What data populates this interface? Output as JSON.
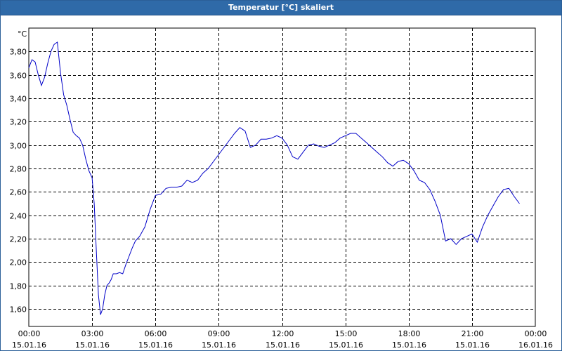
{
  "window": {
    "title": "Temperatur [°C] skaliert"
  },
  "chart_data": {
    "type": "line",
    "title": "Temperatur [°C] skaliert",
    "ylabel": "°C",
    "xlabel": "",
    "grid": true,
    "line_color": "#0000c8",
    "ylim": [
      1.45,
      4.0
    ],
    "y_ticks": [
      "1,60",
      "1,80",
      "2,00",
      "2,20",
      "2,40",
      "2,60",
      "2,80",
      "3,00",
      "3,20",
      "3,40",
      "3,60",
      "3,80"
    ],
    "x_ticks": [
      {
        "time": "00:00",
        "date": "15.01.16"
      },
      {
        "time": "03:00",
        "date": "15.01.16"
      },
      {
        "time": "06:00",
        "date": "15.01.16"
      },
      {
        "time": "09:00",
        "date": "15.01.16"
      },
      {
        "time": "12:00",
        "date": "15.01.16"
      },
      {
        "time": "15:00",
        "date": "15.01.16"
      },
      {
        "time": "18:00",
        "date": "15.01.16"
      },
      {
        "time": "21:00",
        "date": "15.01.16"
      },
      {
        "time": "00:00",
        "date": "16.01.16"
      }
    ],
    "x_range_hours": [
      0,
      24
    ],
    "series": [
      {
        "name": "",
        "x_hours": [
          0.0,
          0.15,
          0.3,
          0.45,
          0.6,
          0.75,
          0.9,
          1.05,
          1.2,
          1.35,
          1.5,
          1.65,
          1.8,
          1.95,
          2.1,
          2.25,
          2.4,
          2.55,
          2.7,
          2.85,
          3.0,
          3.1,
          3.2,
          3.3,
          3.4,
          3.5,
          3.6,
          3.7,
          3.8,
          3.9,
          4.0,
          4.15,
          4.3,
          4.45,
          4.6,
          4.75,
          4.9,
          5.05,
          5.25,
          5.5,
          5.75,
          6.0,
          6.25,
          6.5,
          6.75,
          7.0,
          7.25,
          7.5,
          7.75,
          8.0,
          8.25,
          8.5,
          8.75,
          9.0,
          9.25,
          9.5,
          9.75,
          10.0,
          10.25,
          10.5,
          10.75,
          11.0,
          11.25,
          11.5,
          11.75,
          12.0,
          12.25,
          12.5,
          12.75,
          13.0,
          13.25,
          13.5,
          13.75,
          14.0,
          14.25,
          14.5,
          14.75,
          15.0,
          15.25,
          15.5,
          15.75,
          16.0,
          16.25,
          16.5,
          16.75,
          17.0,
          17.25,
          17.5,
          17.75,
          18.0,
          18.25,
          18.5,
          18.75,
          19.0,
          19.25,
          19.5,
          19.75,
          20.0,
          20.25,
          20.5,
          20.75,
          21.0,
          21.25,
          21.5,
          21.75,
          22.0,
          22.25,
          22.5,
          22.75,
          23.0,
          23.25,
          23.5,
          23.75,
          24.0
        ],
        "y": [
          3.66,
          3.73,
          3.71,
          3.6,
          3.51,
          3.58,
          3.7,
          3.8,
          3.86,
          3.88,
          3.62,
          3.43,
          3.34,
          3.22,
          3.11,
          3.08,
          3.06,
          3.0,
          2.88,
          2.78,
          2.72,
          2.5,
          2.1,
          1.72,
          1.55,
          1.6,
          1.72,
          1.8,
          1.82,
          1.85,
          1.9,
          1.9,
          1.91,
          1.9,
          1.98,
          2.05,
          2.12,
          2.18,
          2.22,
          2.3,
          2.45,
          2.57,
          2.58,
          2.63,
          2.64,
          2.64,
          2.65,
          2.7,
          2.68,
          2.7,
          2.76,
          2.8,
          2.86,
          2.92,
          2.98,
          3.04,
          3.1,
          3.15,
          3.12,
          2.98,
          3.0,
          3.05,
          3.05,
          3.06,
          3.08,
          3.06,
          3.0,
          2.9,
          2.88,
          2.94,
          3.0,
          3.01,
          2.99,
          2.98,
          3.0,
          3.02,
          3.06,
          3.08,
          3.1,
          3.1,
          3.06,
          3.02,
          2.98,
          2.94,
          2.9,
          2.85,
          2.82,
          2.86,
          2.87,
          2.84,
          2.78,
          2.7,
          2.68,
          2.62,
          2.52,
          2.4,
          2.18,
          2.2,
          2.15,
          2.2,
          2.22,
          2.24,
          2.17,
          2.3,
          2.4,
          2.48,
          2.56,
          2.62,
          2.63,
          2.56,
          2.5
        ]
      }
    ]
  }
}
